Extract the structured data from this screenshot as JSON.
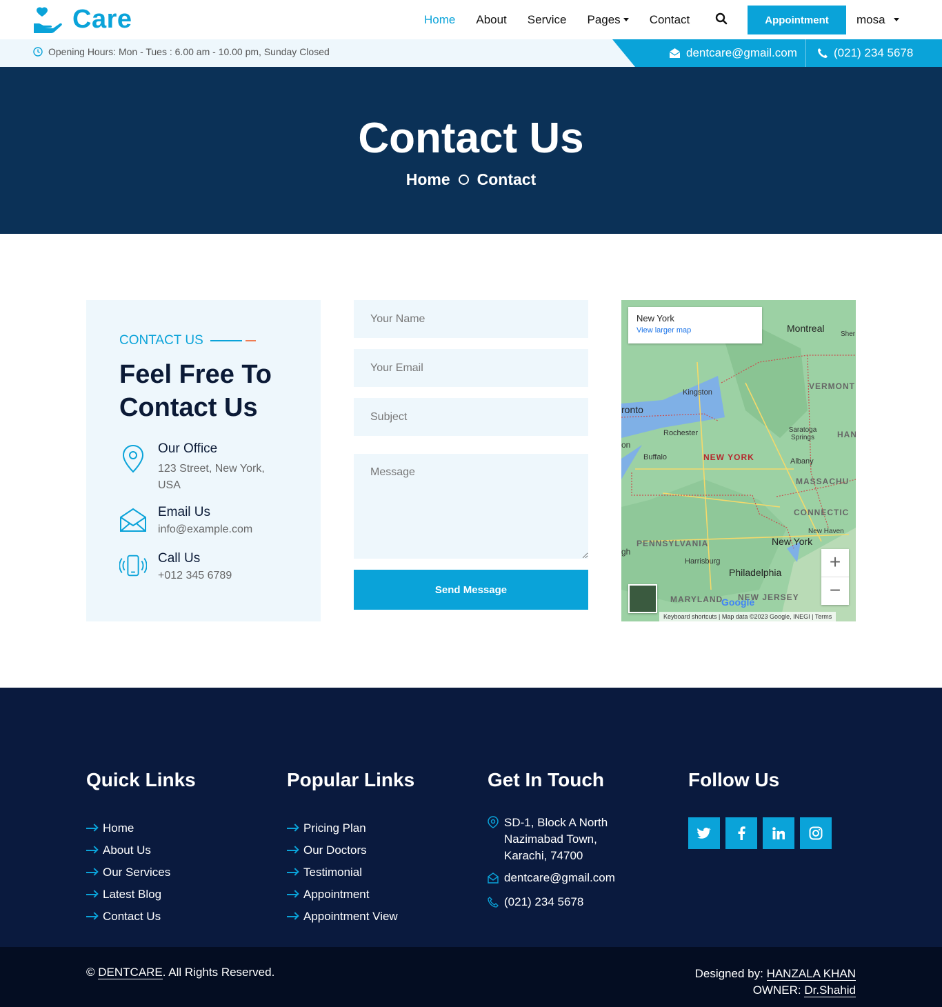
{
  "brand": {
    "name": "Care",
    "accent": "#0aa3d9",
    "navy": "#0b3157"
  },
  "nav": {
    "items": [
      {
        "label": "Home",
        "active": true
      },
      {
        "label": "About"
      },
      {
        "label": "Service"
      },
      {
        "label": "Pages",
        "dropdown": true
      },
      {
        "label": "Contact"
      }
    ],
    "search_icon": "search-icon",
    "appointment": "Appointment",
    "user": "mosa"
  },
  "topbar": {
    "hours": "Opening Hours: Mon - Tues : 6.00 am - 10.00 pm, Sunday Closed",
    "email": "dentcare@gmail.com",
    "phone": "(021) 234 5678"
  },
  "hero": {
    "title": "Contact Us",
    "crumb_home": "Home",
    "crumb_current": "Contact"
  },
  "contact_card": {
    "eyebrow": "CONTACT US",
    "heading": "Feel Free To Contact Us",
    "office_title": "Our Office",
    "office_text": "123 Street, New York, USA",
    "email_title": "Email Us",
    "email_text": "info@example.com",
    "call_title": "Call Us",
    "call_text": "+012 345 6789"
  },
  "form": {
    "name_placeholder": "Your Name",
    "email_placeholder": "Your Email",
    "subject_placeholder": "Subject",
    "message_placeholder": "Message",
    "submit": "Send Message"
  },
  "map": {
    "place": "New York",
    "link": "View larger map",
    "footer": "Keyboard shortcuts | Map data ©2023 Google, INEGI | Terms",
    "labels": {
      "montreal": "Montreal",
      "sher": "Sher",
      "kingston": "Kingston",
      "toronto": "ronto",
      "vermont": "VERMONT",
      "rochester": "Rochester",
      "saratoga": "Saratoga Springs",
      "ham": "HAN",
      "buffalo": "Buffalo",
      "newyork_state": "NEW YORK",
      "albany": "Albany",
      "mass": "MASSACHU",
      "connecticut": "CONNECTIC",
      "new_haven": "New Haven",
      "pennsylvania": "PENNSYLVANIA",
      "nyc": "New York",
      "harrisburg": "Harrisburg",
      "philadelphia": "Philadelphia",
      "gh": "gh",
      "on": "on",
      "maryland": "MARYLAND",
      "new_jersey": "NEW JERSEY",
      "google": "Google"
    }
  },
  "footer": {
    "quick_title": "Quick Links",
    "quick": [
      "Home",
      "About Us",
      "Our Services",
      "Latest Blog",
      "Contact Us"
    ],
    "popular_title": "Popular Links",
    "popular": [
      "Pricing Plan",
      "Our Doctors",
      "Testimonial",
      "Appointment",
      "Appointment View"
    ],
    "touch_title": "Get In Touch",
    "address": "SD-1, Block A North Nazimabad Town, Karachi, 74700",
    "email": "dentcare@gmail.com",
    "phone": "(021) 234 5678",
    "follow_title": "Follow Us",
    "social": [
      "twitter-icon",
      "facebook-icon",
      "linkedin-icon",
      "instagram-icon"
    ]
  },
  "bottom": {
    "copy_prefix": "©",
    "copy_brand": "DENTCARE",
    "copy_suffix": ". All Rights Reserved.",
    "designed_label": "Designed by:",
    "designer": "HANZALA KHAN",
    "owner_label": "OWNER:",
    "owner": "Dr.Shahid"
  }
}
